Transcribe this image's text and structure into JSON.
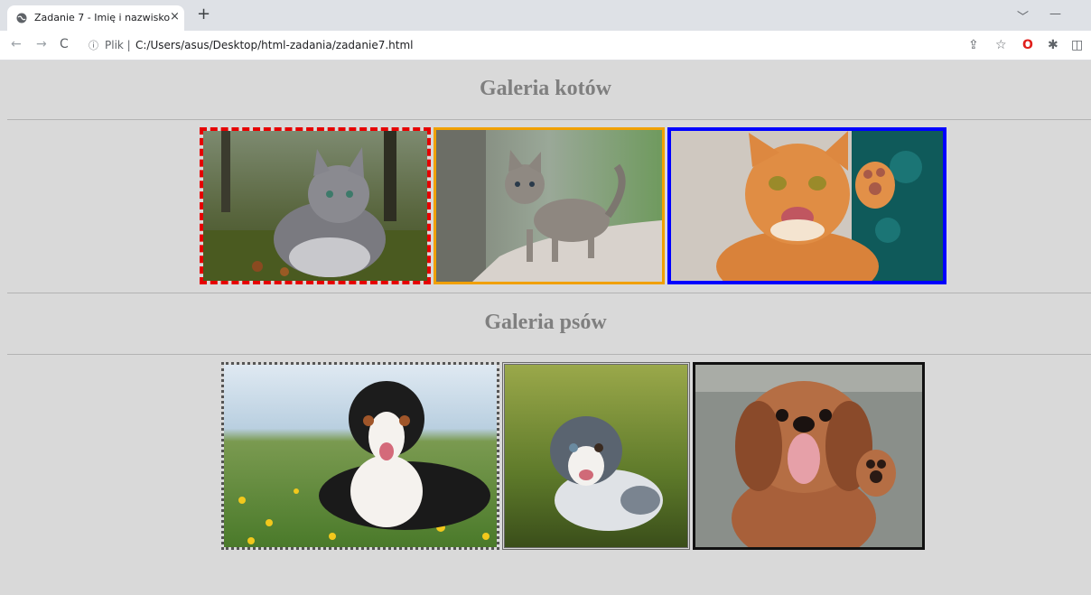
{
  "browser": {
    "tab": {
      "title": "Zadanie 7 - Imię i nazwisko",
      "close": "×"
    },
    "new_tab": "+",
    "window_controls": {
      "dropdown": "﹀",
      "minimize": "—"
    },
    "nav": {
      "back": "←",
      "forward": "→",
      "reload": "C"
    },
    "address": {
      "info": "ⓘ",
      "scheme": "Plik |",
      "url": "C:/Users/asus/Desktop/html-zadania/zadanie7.html"
    },
    "toolbar_icons": {
      "share": "⇪",
      "bookmark": "☆",
      "opera": "O",
      "extensions": "✱",
      "sidepanel": "◫"
    }
  },
  "page": {
    "cats_heading": "Galeria kotów",
    "dogs_heading": "Galeria psów"
  },
  "colors": {
    "page_background": "#d9d9d9",
    "heading": "#7f7f7f",
    "cat1_border": "#e60000",
    "cat2_border": "#f0a000",
    "cat3_border": "#0000ff"
  },
  "images": {
    "cat1": "long-haired grey cat sitting in grass",
    "cat2": "tabby kitten on a rock",
    "cat3": "ginger cat waving paw",
    "dog1": "bernese mountain dog lying in meadow",
    "dog2": "australian shepherd puppy",
    "dog3": "small brown dog with tongue out"
  }
}
